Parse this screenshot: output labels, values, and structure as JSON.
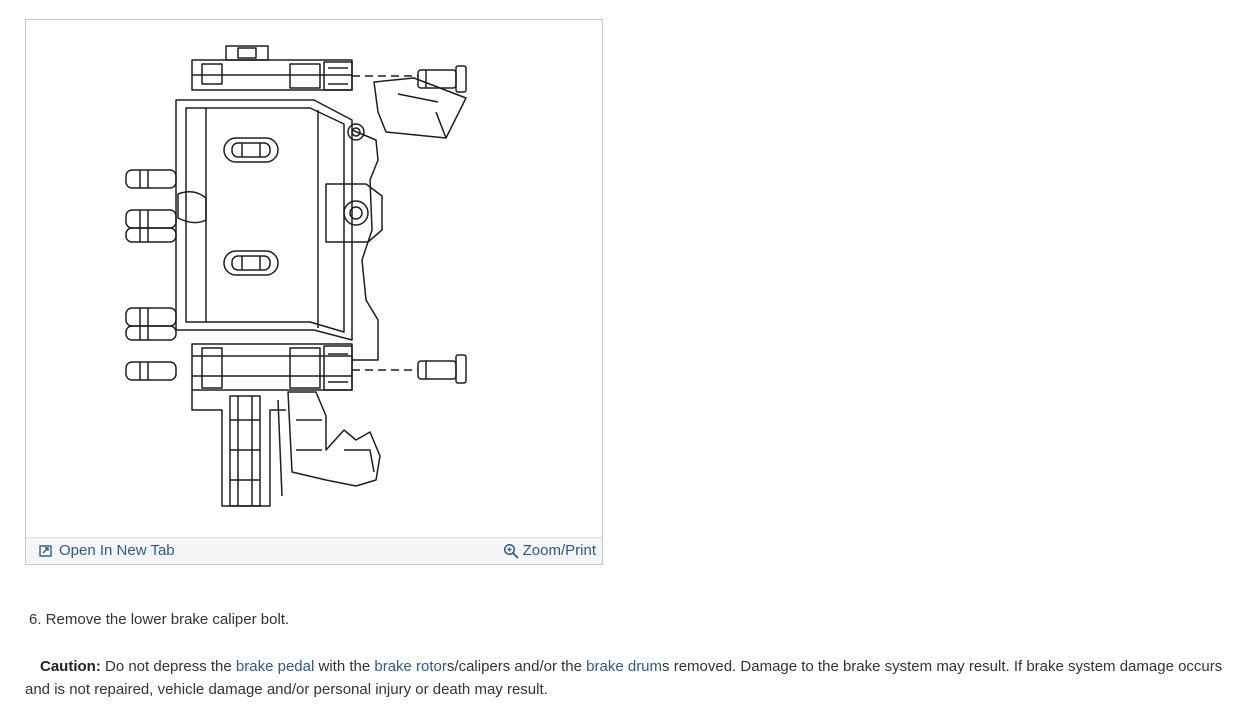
{
  "figure": {
    "open_tab_label": "Open In New Tab",
    "open_tab_icon": "open-new-tab-icon",
    "zoom_label": "Zoom/Print",
    "zoom_icon": "magnifier-plus-icon"
  },
  "step": {
    "text": "6. Remove the lower brake caliper bolt."
  },
  "caution": {
    "label": "Caution:",
    "t1": " Do not depress the ",
    "link1": "brake pedal",
    "t2": " with the ",
    "link2": "brake rotor",
    "t3": "s/calipers and/or the ",
    "link3": "brake drum",
    "t4": "s removed. Damage to the brake system may result. If brake system damage occurs and is not repaired, vehicle damage and/or personal injury or death may result."
  },
  "colors": {
    "link": "#2a5a8f",
    "text": "#333333",
    "figure_border": "#c6c6c6"
  }
}
